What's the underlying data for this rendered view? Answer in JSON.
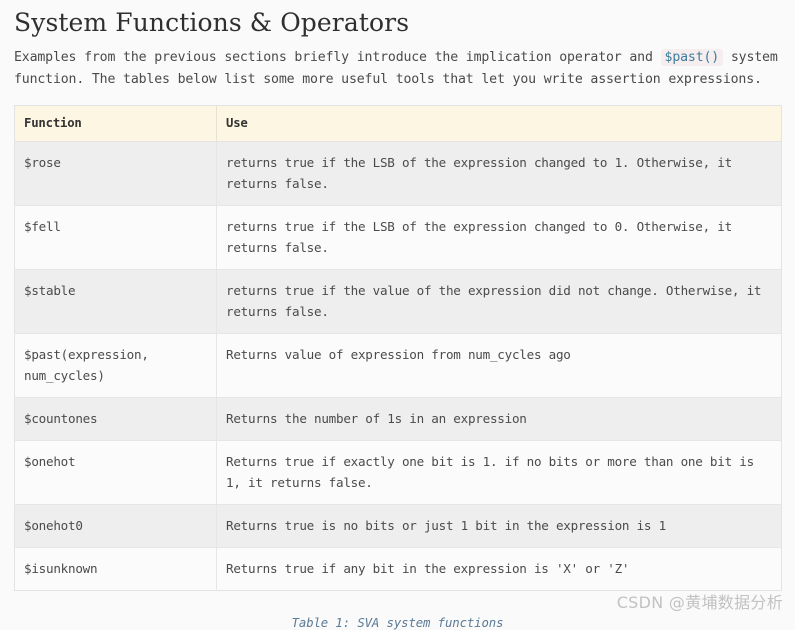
{
  "page": {
    "title": "System Functions & Operators",
    "intro_part1": "Examples from the previous sections briefly introduce the implication operator and ",
    "intro_code": "$past()",
    "intro_part2": " system function. The tables below list some more useful tools that let you write assertion expressions."
  },
  "table": {
    "headers": [
      "Function",
      "Use"
    ],
    "rows": [
      {
        "function": "$rose",
        "use": "returns true if the LSB of the expression changed to 1. Otherwise, it returns false."
      },
      {
        "function": "$fell",
        "use": "returns true if the LSB of the expression changed to 0. Otherwise, it returns false."
      },
      {
        "function": "$stable",
        "use": "returns true if the value of the expression did not change. Otherwise, it returns false."
      },
      {
        "function": "$past(expression, num_cycles)",
        "use": "Returns value of expression from num_cycles ago"
      },
      {
        "function": "$countones",
        "use": "Returns the number of 1s in an expression"
      },
      {
        "function": "$onehot",
        "use": "Returns true if exactly one bit is 1. if no bits or more than one bit is 1, it returns false."
      },
      {
        "function": "$onehot0",
        "use": "Returns true is no bits or just 1 bit in the expression is 1"
      },
      {
        "function": "$isunknown",
        "use": "Returns true if any bit in the expression is 'X' or 'Z'"
      }
    ],
    "caption": "Table 1: SVA system functions"
  },
  "watermark": {
    "text": "CSDN @黄埔数据分析"
  },
  "colors": {
    "page_background": "#fafafa",
    "heading_text": "#2f2f2f",
    "body_text": "#4a4a4a",
    "table_header_background": "#fdf6e3",
    "row_stripe_dark": "#eeeeee",
    "row_stripe_light": "#fbfbfb",
    "border": "#e6e6e6",
    "inline_code_background": "#f6eeee",
    "inline_code_text": "#3c7c9c",
    "caption_text": "#5a7a96",
    "watermark_text": "#c2c2c2"
  }
}
